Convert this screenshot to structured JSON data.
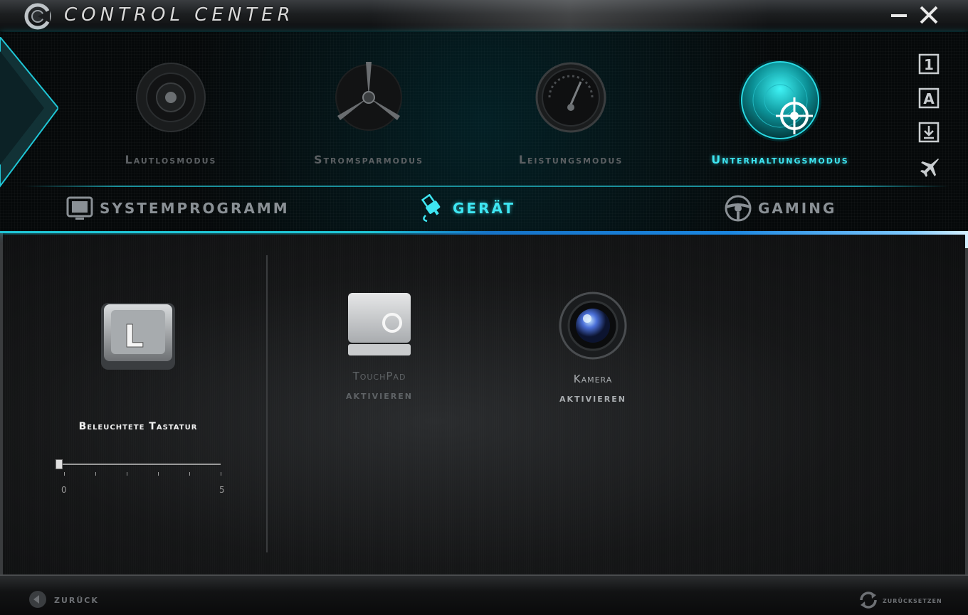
{
  "window": {
    "title": "Control Center",
    "minimize_icon": "minimize-icon",
    "close_icon": "close-icon"
  },
  "modes": [
    {
      "label": "Lautlosmodus",
      "icon": "speaker-icon",
      "active": false
    },
    {
      "label": "Stromsparmodus",
      "icon": "fan-icon",
      "active": false
    },
    {
      "label": "Leistungsmodus",
      "icon": "gauge-icon",
      "active": false
    },
    {
      "label": "Unterhaltungsmodus",
      "icon": "crosshair-icon",
      "active": true
    }
  ],
  "quick_icons": [
    {
      "label": "1",
      "icon": "number-one-icon"
    },
    {
      "label": "A",
      "icon": "letter-a-icon"
    },
    {
      "label": "",
      "icon": "download-icon"
    },
    {
      "label": "",
      "icon": "airplane-icon"
    }
  ],
  "categories": [
    {
      "label": "SYSTEMPROGRAMM",
      "icon": "monitor-icon",
      "active": false
    },
    {
      "label": "GERÄT",
      "icon": "usb-plug-icon",
      "active": true
    },
    {
      "label": "GAMING",
      "icon": "steering-wheel-icon",
      "active": false
    }
  ],
  "keyboard": {
    "key_letter": "L",
    "label": "Beleuchtete Tastatur",
    "slider_min": "0",
    "slider_max": "5",
    "slider_value": 0
  },
  "devices": [
    {
      "title": "TouchPad",
      "action": "aktivieren",
      "icon": "touchpad-icon",
      "enabled": false
    },
    {
      "title": "Kamera",
      "action": "aktivieren",
      "icon": "camera-icon",
      "enabled": true
    }
  ],
  "footer": {
    "back_label": "zurück",
    "reset_label": "zurücksetzen"
  },
  "colors": {
    "accent": "#3ee6f2",
    "ribbon": "#1a86e0",
    "inactive_text": "#5b5f62"
  }
}
